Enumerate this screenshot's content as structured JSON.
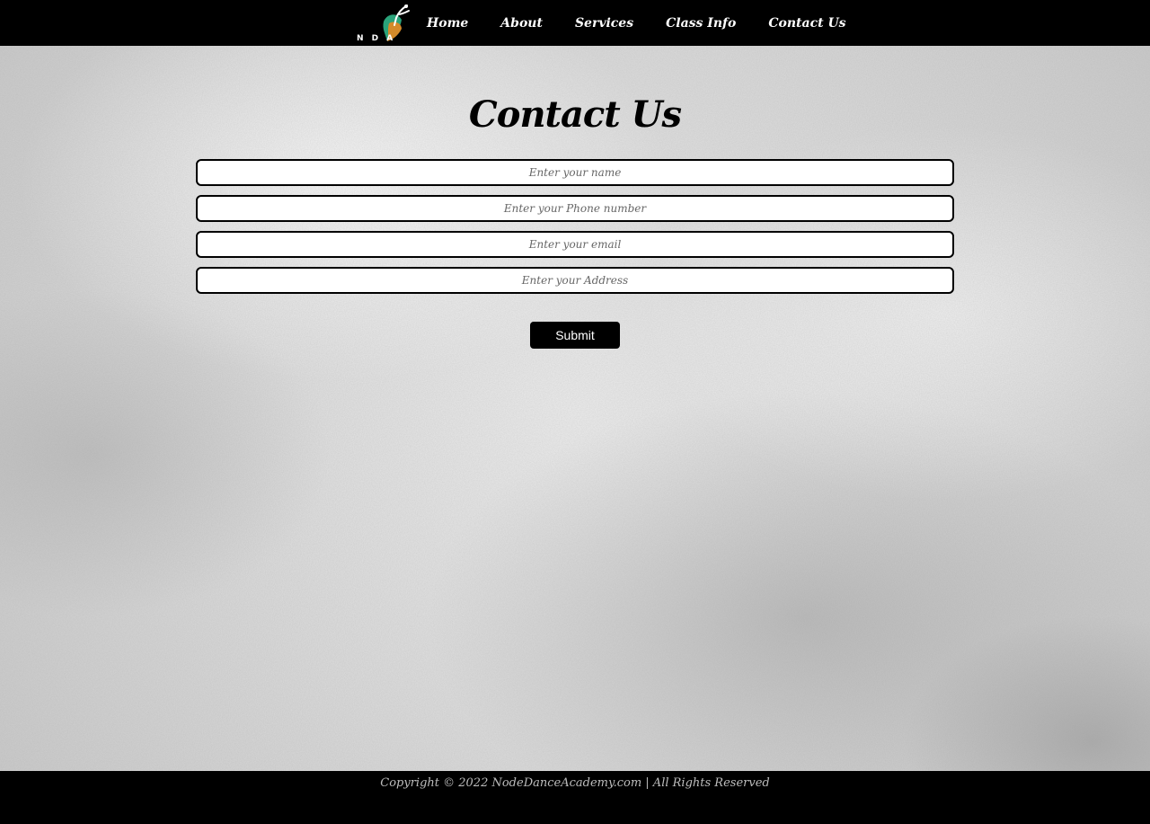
{
  "nav": {
    "logo_text": "N D A",
    "logo_icon": "dancer-leaf-logo",
    "links": [
      "Home",
      "About",
      "Services",
      "Class Info",
      "Contact Us"
    ]
  },
  "main": {
    "title": "Contact Us",
    "fields": {
      "name_placeholder": "Enter your name",
      "phone_placeholder": "Enter your Phone number",
      "email_placeholder": "Enter your email",
      "address_placeholder": "Enter your Address"
    },
    "submit_label": "Submit"
  },
  "footer": {
    "copyright": "Copyright © 2022 NodeDanceAcademy.com | All Rights Reserved"
  },
  "colors": {
    "nav_bg": "#000000",
    "footer_bg": "#000000",
    "button_bg": "#000000",
    "field_border": "#000000"
  }
}
